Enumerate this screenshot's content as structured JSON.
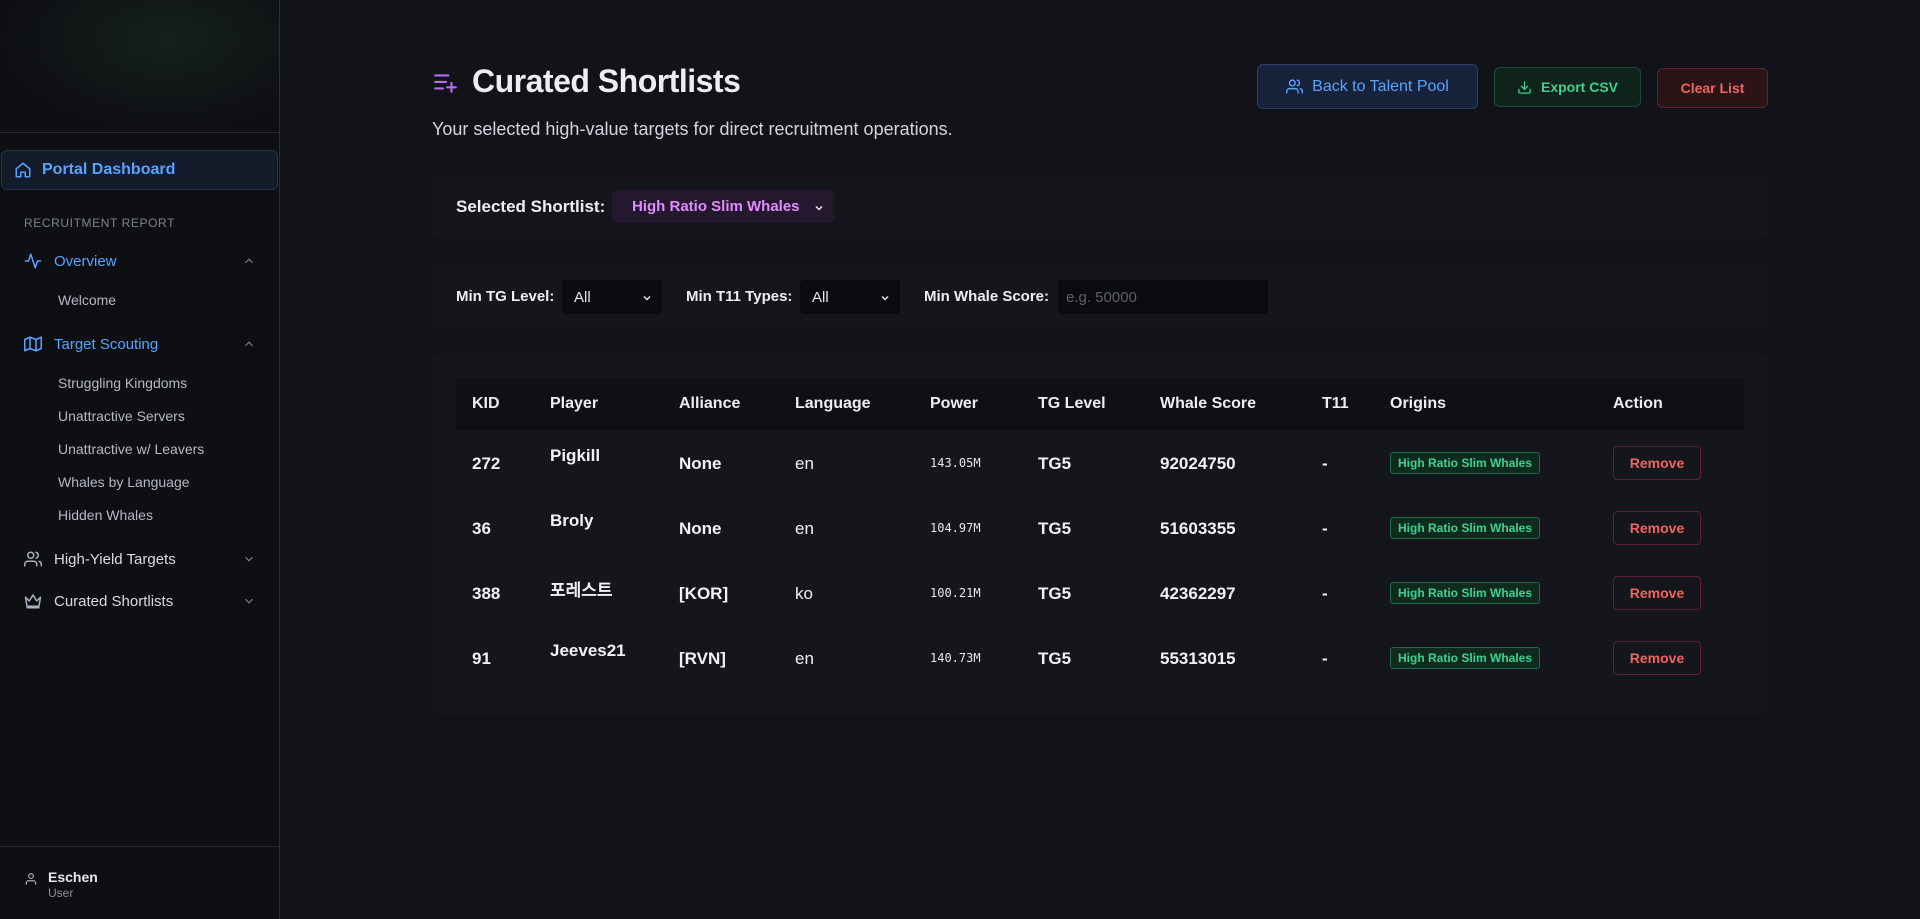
{
  "sidebar": {
    "dashboard_label": "Portal Dashboard",
    "section_label": "RECRUITMENT REPORT",
    "overview": {
      "label": "Overview",
      "items": [
        "Welcome"
      ]
    },
    "target_scouting": {
      "label": "Target Scouting",
      "items": [
        "Struggling Kingdoms",
        "Unattractive Servers",
        "Unattractive w/ Leavers",
        "Whales by Language",
        "Hidden Whales"
      ]
    },
    "high_yield": {
      "label": "High-Yield Targets"
    },
    "curated": {
      "label": "Curated Shortlists"
    },
    "user": {
      "name": "Eschen",
      "role": "User"
    }
  },
  "header": {
    "title": "Curated Shortlists",
    "subtitle": "Your selected high-value targets for direct recruitment operations.",
    "back_label": "Back to Talent Pool",
    "export_label": "Export CSV",
    "clear_label": "Clear List"
  },
  "shortlist": {
    "label": "Selected Shortlist:",
    "selected": "High Ratio Slim Whales"
  },
  "filters": {
    "min_tg_label": "Min TG Level:",
    "min_tg_value": "All",
    "min_t11_label": "Min T11 Types:",
    "min_t11_value": "All",
    "min_whale_label": "Min Whale Score:",
    "min_whale_placeholder": "e.g. 50000"
  },
  "table": {
    "headers": [
      "KID",
      "Player",
      "Alliance",
      "Language",
      "Power",
      "TG Level",
      "Whale Score",
      "T11",
      "Origins",
      "Action"
    ],
    "rows": [
      {
        "kid": "272",
        "player": "Pigkill",
        "alliance": "None",
        "language": "en",
        "power": "143.05M",
        "tg": "TG5",
        "whale": "92024750",
        "t11": "-",
        "origin": "High Ratio Slim Whales",
        "action": "Remove"
      },
      {
        "kid": "36",
        "player": "Broly",
        "alliance": "None",
        "language": "en",
        "power": "104.97M",
        "tg": "TG5",
        "whale": "51603355",
        "t11": "-",
        "origin": "High Ratio Slim Whales",
        "action": "Remove"
      },
      {
        "kid": "388",
        "player": "포레스트",
        "alliance": "[KOR]",
        "language": "ko",
        "power": "100.21M",
        "tg": "TG5",
        "whale": "42362297",
        "t11": "-",
        "origin": "High Ratio Slim Whales",
        "action": "Remove"
      },
      {
        "kid": "91",
        "player": "Jeeves21",
        "alliance": "[RVN]",
        "language": "en",
        "power": "140.73M",
        "tg": "TG5",
        "whale": "55313015",
        "t11": "-",
        "origin": "High Ratio Slim Whales",
        "action": "Remove"
      }
    ]
  },
  "icons": {
    "home": "home-icon",
    "activity": "activity-icon",
    "map": "map-icon",
    "users": "users-icon",
    "crown": "crown-icon",
    "user": "user-icon",
    "list_add": "list-plus-icon",
    "download": "download-icon"
  },
  "colors": {
    "accent_blue": "#5aa2ff",
    "accent_purple": "#b46cff",
    "accent_green": "#3ed18f",
    "accent_red": "#f2645f"
  }
}
